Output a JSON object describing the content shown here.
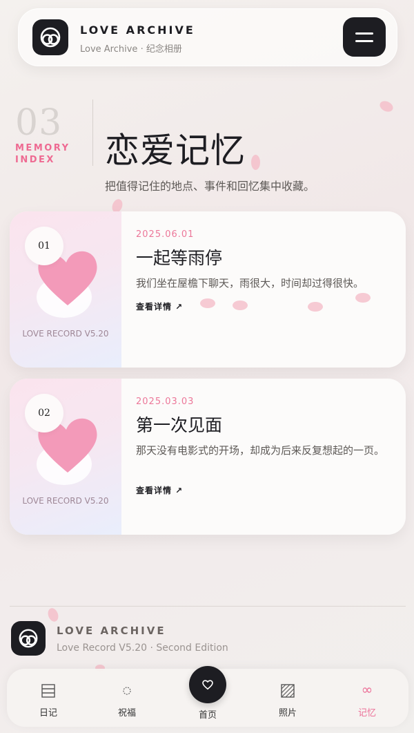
{
  "header": {
    "brand": "LOVE ARCHIVE",
    "subtitle": "Love Archive · 纪念相册",
    "menu_icon": "hamburger-menu-icon"
  },
  "section": {
    "number": "03",
    "tag_line1": "MEMORY",
    "tag_line2": "INDEX",
    "title": "恋爱记忆",
    "description": "把值得记住的地点、事件和回忆集中收藏。"
  },
  "memories": [
    {
      "num": "01",
      "media_label": "LOVE RECORD V5.20",
      "date": "2025.06.01",
      "title": "一起等雨停",
      "description": "我们坐在屋檐下聊天，雨很大，时间却过得很快。",
      "link": "查看详情 ↗"
    },
    {
      "num": "02",
      "media_label": "LOVE RECORD V5.20",
      "date": "2025.03.03",
      "title": "第一次见面",
      "description": "那天没有电影式的开场，却成为后来反复想起的一页。",
      "link": "查看详情 ↗"
    }
  ],
  "footer": {
    "title": "LOVE ARCHIVE",
    "subtitle": "Love Record V5.20 · Second Edition"
  },
  "nav": {
    "diary": "日记",
    "wishes": "祝福",
    "home": "首页",
    "photos": "照片",
    "memories": "记忆"
  },
  "colors": {
    "accent": "#ec6f97",
    "dark": "#1d1d22",
    "heart": "#f39ab9"
  }
}
